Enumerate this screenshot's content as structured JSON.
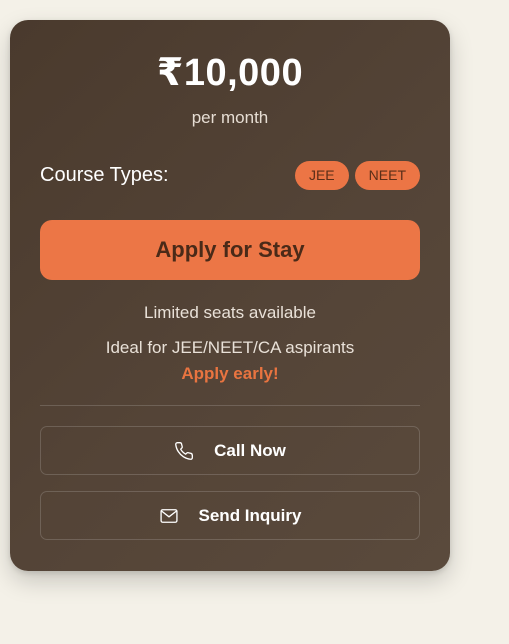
{
  "pricing": {
    "price": "₹10,000",
    "period": "per month"
  },
  "course": {
    "label": "Course Types:",
    "types": [
      "JEE",
      "NEET"
    ]
  },
  "apply_button": "Apply for Stay",
  "notes": {
    "seats": "Limited seats available",
    "ideal": "Ideal for JEE/NEET/CA aspirants",
    "early": "Apply early!"
  },
  "actions": {
    "call": {
      "label": "Call Now",
      "icon": "phone-icon"
    },
    "inquiry": {
      "label": "Send Inquiry",
      "icon": "mail-icon"
    }
  },
  "colors": {
    "accent": "#ec7646",
    "card": "#4f3f33",
    "background": "#f4f1e8"
  }
}
